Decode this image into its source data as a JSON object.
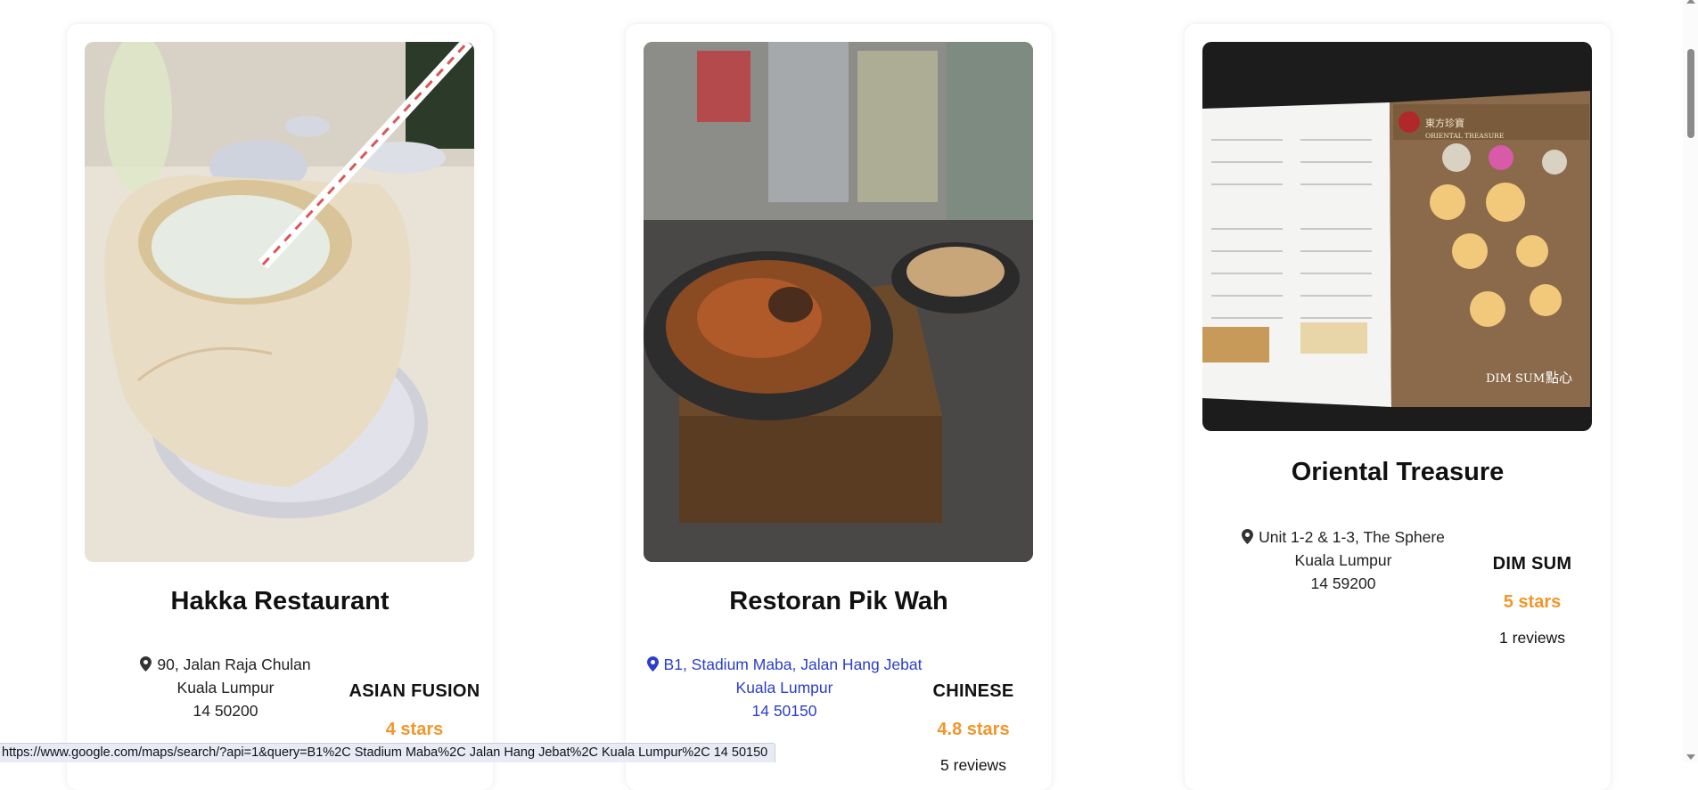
{
  "restaurants": [
    {
      "name": "Hakka Restaurant",
      "address_line1": "90, Jalan Raja Chulan",
      "address_line2": "Kuala Lumpur",
      "address_line3": "14 50200",
      "cuisine": "ASIAN FUSION",
      "stars": "4 stars",
      "reviews": "",
      "photo": "coconut-drink-photo"
    },
    {
      "name": "Restoran Pik Wah",
      "address_line1": "B1, Stadium Maba, Jalan Hang Jebat",
      "address_line2": "Kuala Lumpur",
      "address_line3": "14 50150",
      "cuisine": "CHINESE",
      "stars": "4.8 stars",
      "reviews": "5 reviews",
      "photo": "claypot-noodles-photo"
    },
    {
      "name": "Oriental Treasure",
      "address_line1": "Unit 1-2 & 1-3, The Sphere",
      "address_line2": "Kuala Lumpur",
      "address_line3": "14 59200",
      "cuisine": "DIM SUM",
      "stars": "5 stars",
      "reviews": "1 reviews",
      "photo": "dim-sum-menu-photo"
    }
  ],
  "menu_photo_text": {
    "brand_cn": "東方珍寶",
    "brand_en": "ORIENTAL TREASURE",
    "footer_en": "DIM SUM",
    "footer_cn": "點心"
  },
  "status_bar_url": "https://www.google.com/maps/search/?api=1&query=B1%2C Stadium Maba%2C Jalan Hang Jebat%2C Kuala Lumpur%2C 14 50150",
  "colors": {
    "stars": "#f0962a",
    "hovered_link": "#2b3fc8"
  }
}
